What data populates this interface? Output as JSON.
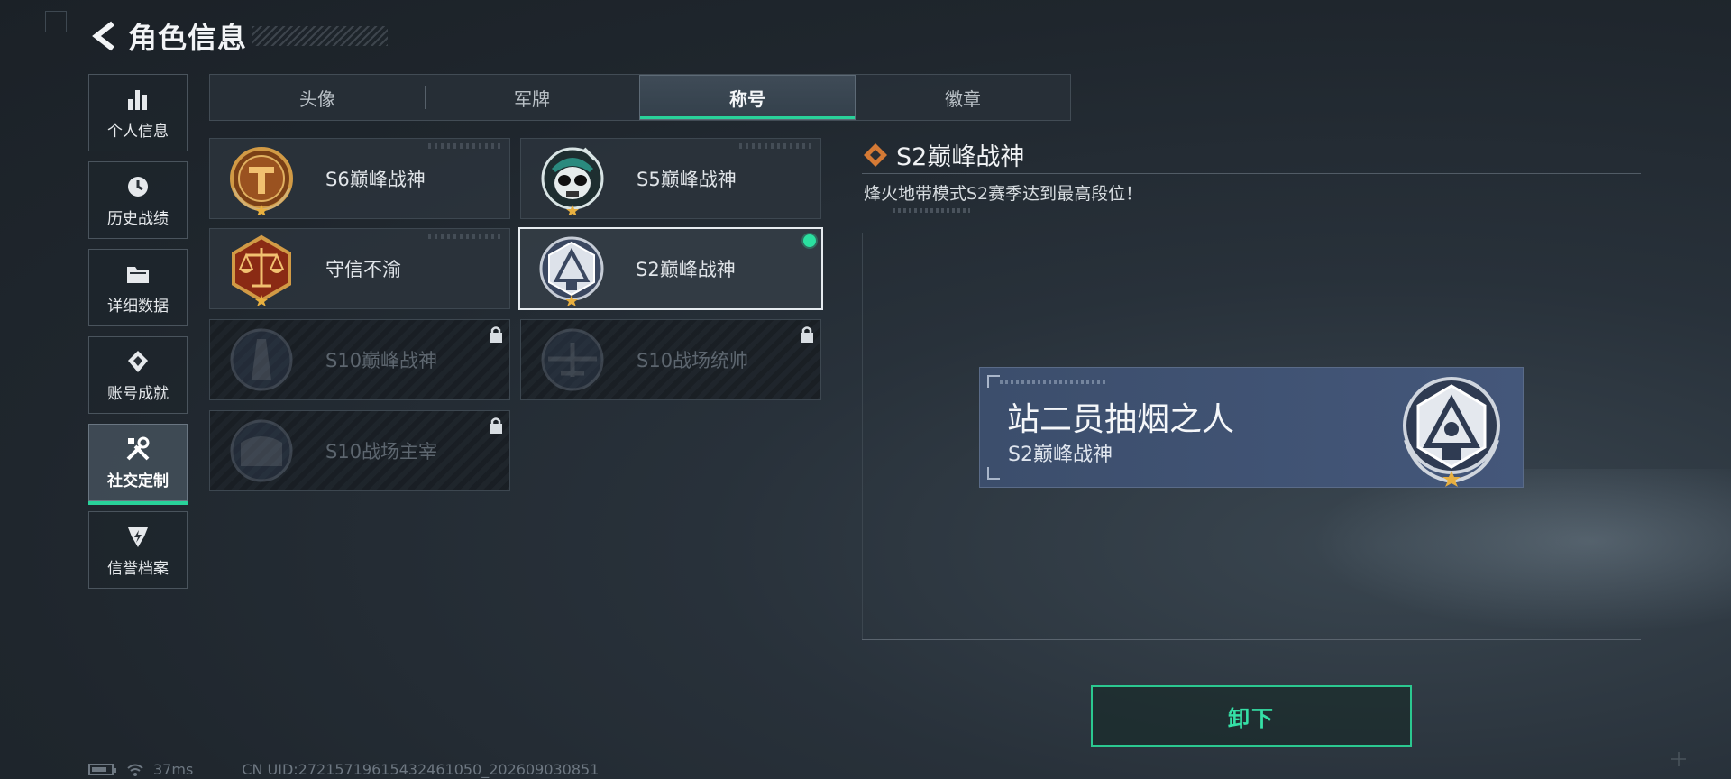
{
  "header": {
    "title": "角色信息"
  },
  "sidebar": {
    "items": [
      {
        "label": "个人信息",
        "icon": "bar-chart-icon"
      },
      {
        "label": "历史战绩",
        "icon": "history-clock-icon"
      },
      {
        "label": "详细数据",
        "icon": "folder-icon"
      },
      {
        "label": "账号成就",
        "icon": "achievement-icon"
      },
      {
        "label": "社交定制",
        "icon": "tools-icon",
        "active": true
      },
      {
        "label": "信誉档案",
        "icon": "shield-bolt-icon"
      }
    ]
  },
  "tabs": [
    {
      "label": "头像"
    },
    {
      "label": "军牌"
    },
    {
      "label": "称号",
      "active": true
    },
    {
      "label": "徽章"
    }
  ],
  "titles": [
    {
      "label": "S6巅峰战神",
      "emblem": "gold-t-emblem",
      "locked": false
    },
    {
      "label": "S5巅峰战神",
      "emblem": "skull-emblem",
      "locked": false
    },
    {
      "label": "守信不渝",
      "emblem": "scales-emblem",
      "locked": false
    },
    {
      "label": "S2巅峰战神",
      "emblem": "silver-delta-emblem",
      "locked": false,
      "selected": true,
      "equipped": true
    },
    {
      "label": "S10巅峰战神",
      "emblem": "tower-emblem",
      "locked": true
    },
    {
      "label": "S10战场统帅",
      "emblem": "aircraft-emblem",
      "locked": true
    },
    {
      "label": "S10战场主宰",
      "emblem": "colosseum-emblem",
      "locked": true
    }
  ],
  "detail": {
    "title": "S2巅峰战神",
    "description": "烽火地带模式S2赛季达到最高段位！",
    "preview": {
      "player_name": "站二员抽烟之人",
      "title": "S2巅峰战神"
    },
    "unequip_label": "卸下"
  },
  "status_bar": {
    "ping": "37ms",
    "uid": "CN UID:27215719615432461050_202609030851"
  },
  "colors": {
    "accent": "#29d29a",
    "preview_bg": "#44577a",
    "gold": "#c08a3a"
  }
}
